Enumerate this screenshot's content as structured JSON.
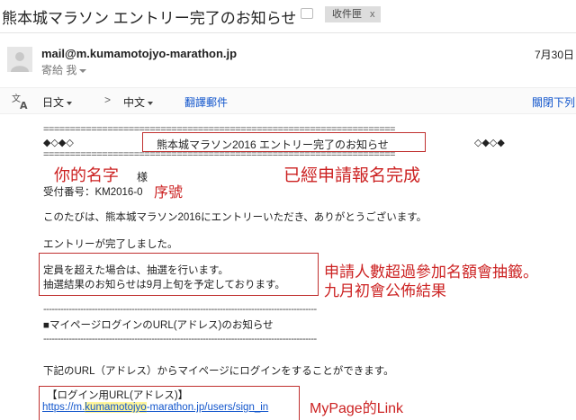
{
  "header": {
    "subject": "熊本城マラソン エントリー完了のお知らせ",
    "inbox_chip": "收件匣",
    "inbox_chip_close": "x"
  },
  "message": {
    "sender": "mail@m.kumamotojyo-marathon.jp",
    "recipient": "寄給 我",
    "date": "7月30日"
  },
  "translate_bar": {
    "from_language": "日文",
    "arrow": ">",
    "to_language": "中文",
    "translate_link": "翻譯郵件",
    "turn_off": "關閉下列"
  },
  "email_body": {
    "separator_eq": "==================================================================",
    "diamonds_left": "◆◇◆◇",
    "diamonds_right": "◇◆◇◆",
    "title": "熊本城マラソン2016 エントリー完了のお知らせ",
    "name_suffix": "様",
    "reception_number": "受付番号：KM2016-0",
    "thanks": "このたびは、熊本城マラソン2016にエントリーいただき、ありがとうございます。",
    "entry_complete": "エントリーが完了しました。",
    "lottery_line1": "定員を超えた場合は、抽選を行います。",
    "lottery_line2": "抽選結果のお知らせは9月上旬を予定しております。",
    "separator_dash": "------------------------------------------------------------------------------------------------",
    "mypage_heading": "■マイページログインのURL(アドレス)のお知らせ",
    "login_instruction": "下記のURL（アドレス）からマイページにログインをすることができます。",
    "login_url_label": "【ログイン用URL(アドレス)】",
    "login_url_pre": "https://m.",
    "login_url_hl": "kumamotojyo",
    "login_url_post": "-marathon.jp/users/sign_in"
  },
  "annotations": {
    "your_name": "你的名字",
    "applied": "已經申請報名完成",
    "serial": "序號",
    "lottery1": "申請人數超過參加名額會抽籤。",
    "lottery2": "九月初會公佈結果",
    "mypage_link": "MyPage的Link"
  },
  "colors": {
    "annotation_red": "#cc2222",
    "link_blue": "#1155cc",
    "highlight_yellow": "#fff59a"
  }
}
